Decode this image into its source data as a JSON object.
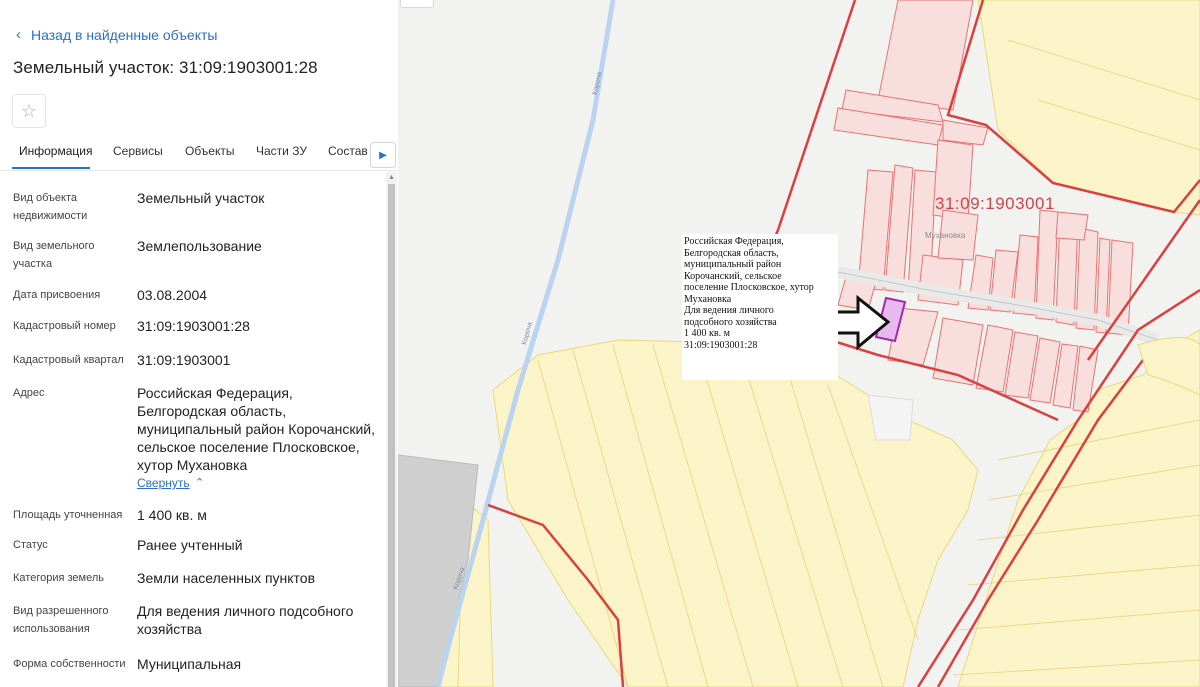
{
  "panel": {
    "back_label": "Назад в найденные объекты",
    "title": "Земельный участок: 31:09:1903001:28",
    "star_icon": "star-outline-icon",
    "tabs": [
      "Информация",
      "Сервисы",
      "Объекты",
      "Части ЗУ",
      "Состав"
    ],
    "active_tab": "Информация",
    "rows": [
      {
        "label": "Вид объекта недвижимости",
        "value": "Земельный участок"
      },
      {
        "label": "Вид земельного участка",
        "value": "Землепользование"
      },
      {
        "label": "Дата присвоения",
        "value": "03.08.2004"
      },
      {
        "label": "Кадастровый номер",
        "value": "31:09:1903001:28"
      },
      {
        "label": "Кадастровый квартал",
        "value": "31:09:1903001"
      },
      {
        "label": "Адрес",
        "value": "Российская Федерация, Белгородская область, муниципальный район Корочанский, сельское поселение Плосковское, хутор Мухановка"
      },
      {
        "label": "Площадь уточненная",
        "value": "1 400 кв. м"
      },
      {
        "label": "Статус",
        "value": "Ранее учтенный"
      },
      {
        "label": "Категория земель",
        "value": "Земли населенных пунктов"
      },
      {
        "label": "Вид разрешенного использования",
        "value": "Для ведения личного подсобного хозяйства"
      },
      {
        "label": "Форма собственности",
        "value": "Муниципальная"
      }
    ],
    "collapse_label": "Свернуть"
  },
  "map": {
    "popup_text": "Российская Федерация,\nБелгородская область,\nмуниципальный район\nКорочанский, сельское\nпоселение Плосковское, хутор\nМухановка\nДля ведения личного\nподсобного хозяйства\n1 400 кв. м\n31:09:1903001:28",
    "quarter_label": "31:09:1903001",
    "village_label": "Мухановка",
    "road_label": "Короча",
    "colors": {
      "field_fill": "#fbf4c8",
      "field_stroke": "#e9d97a",
      "parcel_fill": "#f9dede",
      "parcel_stroke": "#e8736f",
      "boundary": "#d9403f",
      "selected": "#a22aa8",
      "river": "#b9d3f1"
    }
  }
}
